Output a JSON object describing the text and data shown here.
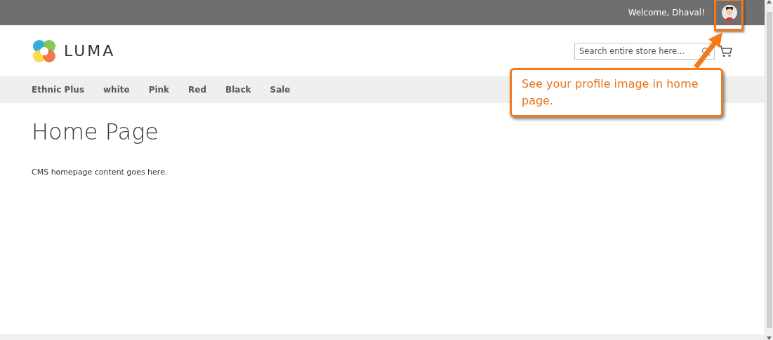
{
  "top_bar": {
    "welcome": "Welcome, Dhaval!"
  },
  "header": {
    "logo_text": "LUMA",
    "search": {
      "placeholder": "Search entire store here..."
    }
  },
  "nav": {
    "items": [
      {
        "label": "Ethnic Plus"
      },
      {
        "label": "white"
      },
      {
        "label": "Pink"
      },
      {
        "label": "Red"
      },
      {
        "label": "Black"
      },
      {
        "label": "Sale"
      }
    ]
  },
  "main": {
    "title": "Home Page",
    "content": "CMS homepage content goes here."
  },
  "callout": {
    "text": "See your profile image in home page."
  }
}
